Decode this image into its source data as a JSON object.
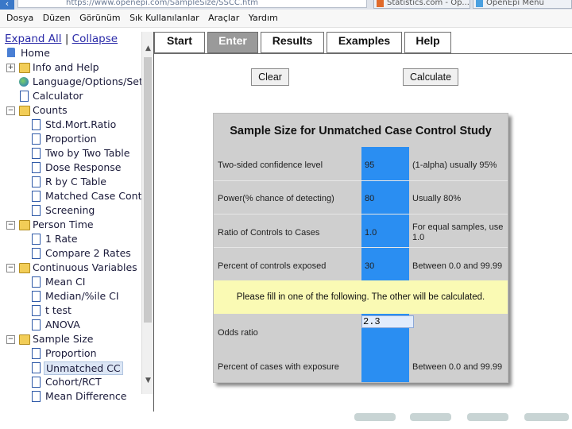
{
  "browser": {
    "address": "https://www.openepi.com/SampleSize/SSCC.htm",
    "tabs": [
      {
        "label": "Statistics.com - Op..."
      },
      {
        "label": "OpenEpi Menu"
      }
    ]
  },
  "menubar": [
    "Dosya",
    "Düzen",
    "Görünüm",
    "Sık Kullanılanlar",
    "Araçlar",
    "Yardım"
  ],
  "tree": {
    "expand_all": "Expand All",
    "separator": "|",
    "collapse": "Collapse",
    "home": "Home",
    "info_help": "Info and Help",
    "language": "Language/Options/Set",
    "calculator": "Calculator",
    "counts": "Counts",
    "counts_items": [
      "Std.Mort.Ratio",
      "Proportion",
      "Two by Two Table",
      "Dose Response",
      "R by C Table",
      "Matched Case Cont",
      "Screening"
    ],
    "person_time": "Person Time",
    "person_time_items": [
      "1 Rate",
      "Compare 2 Rates"
    ],
    "continuous": "Continuous Variables",
    "continuous_items": [
      "Mean CI",
      "Median/%ile CI",
      "t test",
      "ANOVA"
    ],
    "sample_size": "Sample Size",
    "sample_size_items": [
      "Proportion",
      "Unmatched CC",
      "Cohort/RCT",
      "Mean Difference"
    ]
  },
  "app_tabs": [
    "Start",
    "Enter",
    "Results",
    "Examples",
    "Help"
  ],
  "buttons": {
    "clear": "Clear",
    "calculate": "Calculate"
  },
  "study": {
    "title": "Sample Size for Unmatched Case Control Study",
    "rows": [
      {
        "label": "Two-sided confidence level",
        "value": "95",
        "note": "(1-alpha) usually 95%"
      },
      {
        "label": "Power(% chance of detecting)",
        "value": "80",
        "note": "Usually 80%"
      },
      {
        "label": "Ratio of Controls to Cases",
        "value": "1.0",
        "note": "For equal samples, use 1.0"
      },
      {
        "label": "Percent of controls exposed",
        "value": "30",
        "note": "Between 0.0 and 99.99"
      }
    ],
    "fill_note": "Please fill in one of the following. The other will be calculated.",
    "odds_label": "Odds ratio",
    "odds_value": "2.3",
    "cases_label": "Percent of cases with exposure",
    "cases_note": "Between 0.0 and 99.99"
  },
  "colors": {
    "value_column": "#2a8ef2",
    "panel_bg": "#cfcfcf",
    "fill_band": "#fafab4",
    "active_tab": "#9a9a9a"
  }
}
